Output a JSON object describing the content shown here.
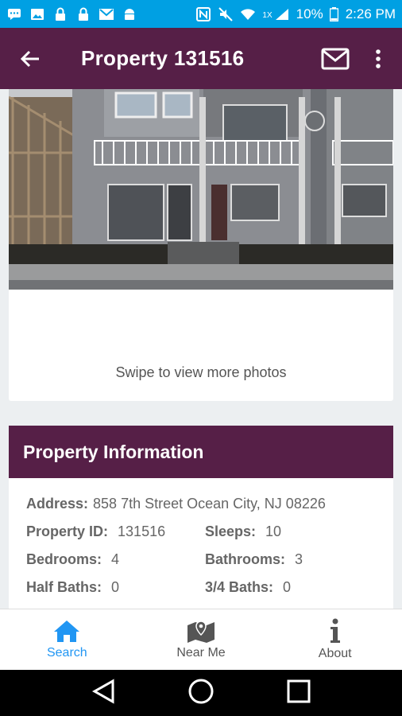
{
  "statusbar": {
    "left_icons": [
      "chat-icon",
      "image-icon",
      "lock-icon",
      "lock-icon",
      "mail-icon",
      "android-icon"
    ],
    "right_icons": [
      "nfc-icon",
      "mute-icon",
      "wifi-icon",
      "signal-icon",
      "battery-icon"
    ],
    "network_label": "1X",
    "battery": "10%",
    "time": "2:26 PM"
  },
  "appbar": {
    "title": "Property 131516",
    "color": "#561f47"
  },
  "photo": {
    "swipe_hint": "Swipe to view more photos"
  },
  "info": {
    "header": "Property Information",
    "address_label": "Address:",
    "address_value": "858 7th Street Ocean City, NJ 08226",
    "property_id_label": "Property ID:",
    "property_id_value": "131516",
    "sleeps_label": "Sleeps:",
    "sleeps_value": "10",
    "bedrooms_label": "Bedrooms:",
    "bedrooms_value": "4",
    "bathrooms_label": "Bathrooms:",
    "bathrooms_value": "3",
    "half_baths_label": "Half Baths:",
    "half_baths_value": "0",
    "three_quarter_baths_label": "3/4 Baths:",
    "three_quarter_baths_value": "0"
  },
  "bottomnav": {
    "items": [
      {
        "label": "Search",
        "icon": "home-icon",
        "active": true
      },
      {
        "label": "Near Me",
        "icon": "map-icon",
        "active": false
      },
      {
        "label": "About",
        "icon": "info-icon",
        "active": false
      }
    ],
    "active_color": "#2196f3"
  }
}
